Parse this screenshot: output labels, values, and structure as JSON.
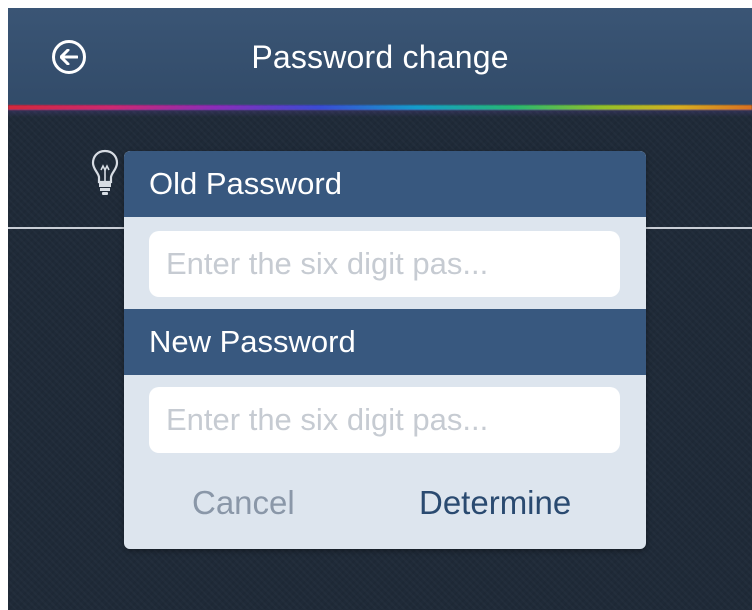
{
  "navbar": {
    "title": "Password change",
    "back_icon": "arrow-left-circle-icon"
  },
  "background": {
    "hint_icon": "lightbulb-icon"
  },
  "dialog": {
    "old_password": {
      "label": "Old Password",
      "placeholder": "Enter the six digit pas...",
      "value": ""
    },
    "new_password": {
      "label": "New Password",
      "placeholder": "Enter the six digit pas...",
      "value": ""
    },
    "cancel_label": "Cancel",
    "confirm_label": "Determine"
  },
  "colors": {
    "navbar": "#36506f",
    "header": "#38587f",
    "dialog_bg": "#dde5ee",
    "cancel_text": "#8a97a8",
    "confirm_text": "#2a4a70"
  }
}
